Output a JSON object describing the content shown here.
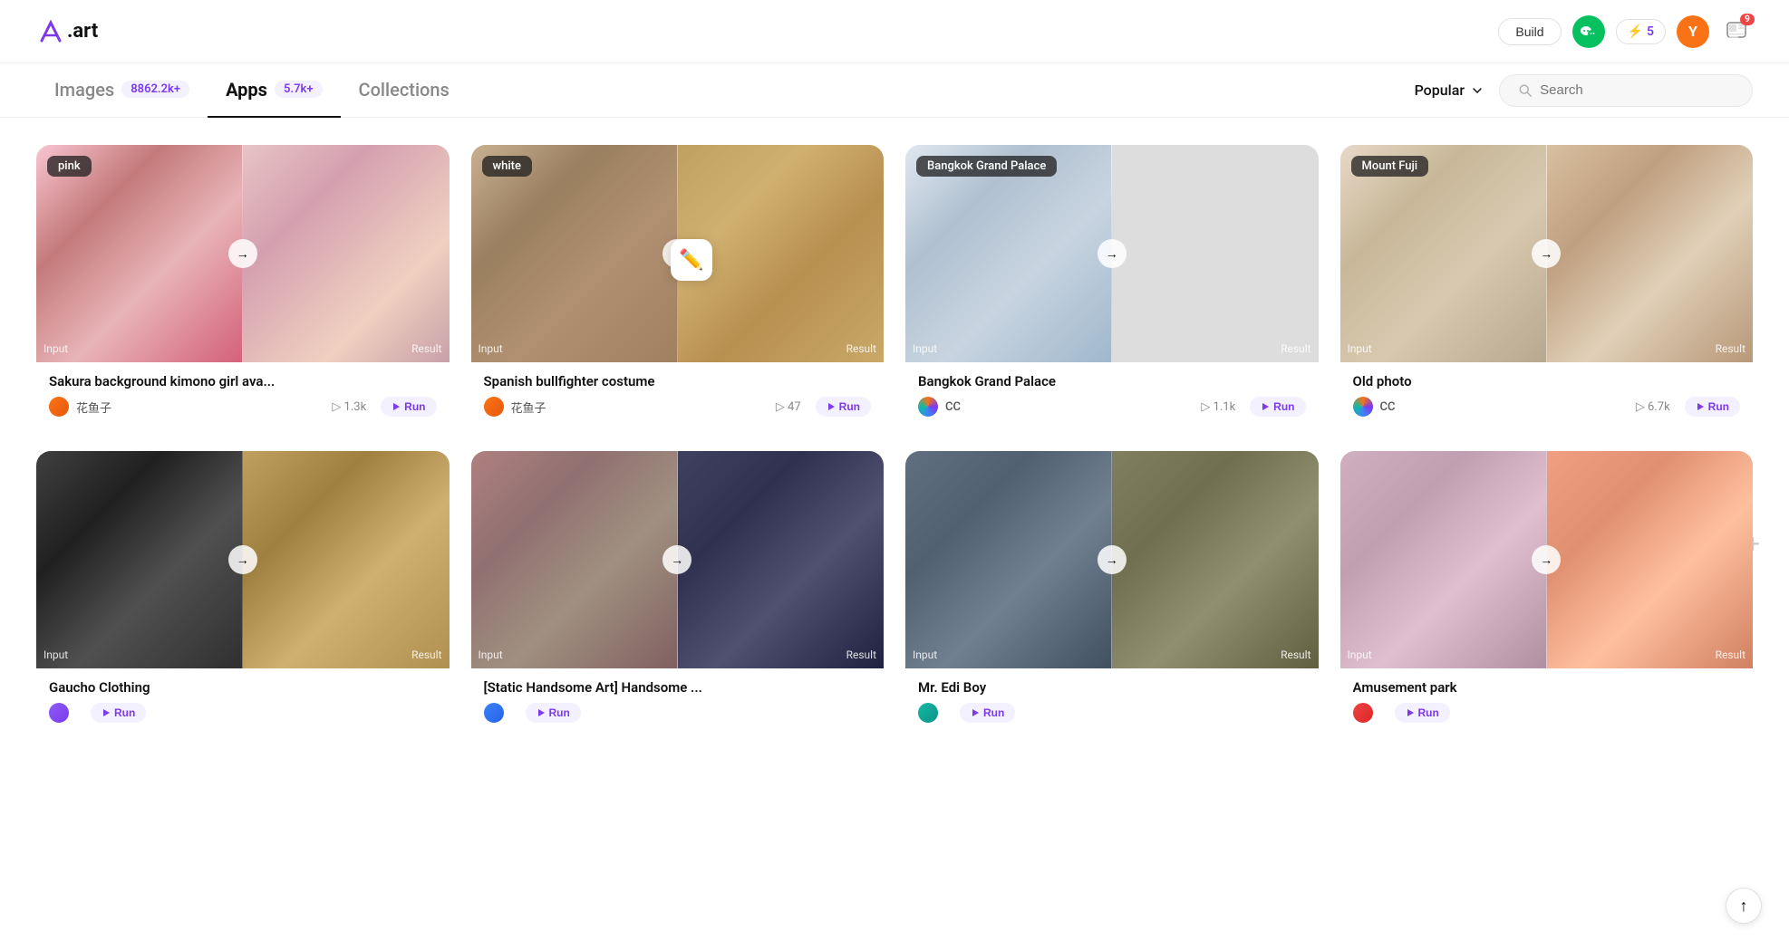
{
  "logo": {
    "text": ".art",
    "aria": "A.art logo"
  },
  "header": {
    "build_label": "Build",
    "lightning_count": "5",
    "user_initial": "Y",
    "notification_count": "9"
  },
  "nav": {
    "tabs": [
      {
        "id": "images",
        "label": "Images",
        "badge": "8862.2k+",
        "active": false
      },
      {
        "id": "apps",
        "label": "Apps",
        "badge": "5.7k+",
        "active": true
      },
      {
        "id": "collections",
        "label": "Collections",
        "badge": "",
        "active": false
      }
    ],
    "sort_label": "Popular",
    "search_placeholder": "Search"
  },
  "cards": [
    {
      "id": "sakura",
      "label": "pink",
      "title": "Sakura background kimono girl ava...",
      "author": "花鱼子",
      "views": "1.3k",
      "run_label": "Run",
      "avatar_class": "avatar-orange",
      "bg_left": "bg-sakura-left",
      "bg_right": "bg-sakura-right",
      "input_label": "Input",
      "arrow": "→",
      "result_label": "Result"
    },
    {
      "id": "bullfighter",
      "label": "white",
      "title": "Spanish bullfighter costume",
      "author": "花鱼子",
      "views": "47",
      "run_label": "Run",
      "avatar_class": "avatar-orange",
      "bg_left": "bg-bull-left",
      "bg_right": "bg-bull-right",
      "input_label": "Input",
      "arrow": "→",
      "result_label": "Result",
      "has_pencil": true
    },
    {
      "id": "bangkok",
      "label": "Bangkok Grand Palace",
      "title": "Bangkok Grand Palace",
      "author": "CC",
      "views": "1.1k",
      "run_label": "Run",
      "avatar_class": "avatar-multi",
      "bg_left": "bg-bangkok-left",
      "bg_right": "bg-bangkok-right",
      "input_label": "Input",
      "arrow": "→",
      "result_label": "Result"
    },
    {
      "id": "oldphoto",
      "label": "Mount Fuji",
      "title": "Old photo",
      "author": "CC",
      "views": "6.7k",
      "run_label": "Run",
      "avatar_class": "avatar-multi",
      "bg_left": "bg-oldphoto-left",
      "bg_right": "bg-oldphoto-right",
      "input_label": "Input",
      "arrow": "→",
      "result_label": "Result"
    },
    {
      "id": "gaucho",
      "label": "",
      "title": "Gaucho Clothing",
      "author": "",
      "views": "",
      "run_label": "Run",
      "avatar_class": "avatar-purple",
      "bg_left": "bg-gaucho-left",
      "bg_right": "bg-gaucho-right",
      "input_label": "Input",
      "arrow": "→",
      "result_label": "Result"
    },
    {
      "id": "handsome",
      "label": "",
      "title": "[Static Handsome Art] Handsome ...",
      "author": "",
      "views": "",
      "run_label": "Run",
      "avatar_class": "avatar-blue",
      "bg_left": "bg-handsome-left",
      "bg_right": "bg-handsome-right",
      "input_label": "Input",
      "arrow": "→",
      "result_label": "Result"
    },
    {
      "id": "mredi",
      "label": "",
      "title": "Mr. Edi Boy",
      "author": "",
      "views": "",
      "run_label": "Run",
      "avatar_class": "avatar-teal",
      "bg_left": "bg-mredi-left",
      "bg_right": "bg-mredi-right",
      "input_label": "Input",
      "arrow": "→",
      "result_label": "Result"
    },
    {
      "id": "amusement",
      "label": "",
      "title": "Amusement park",
      "author": "",
      "views": "",
      "run_label": "Run",
      "avatar_class": "avatar-red",
      "bg_left": "bg-amusement-left",
      "bg_right": "bg-amusement-right",
      "input_label": "Input",
      "arrow": "→",
      "result_label": "Result"
    }
  ]
}
